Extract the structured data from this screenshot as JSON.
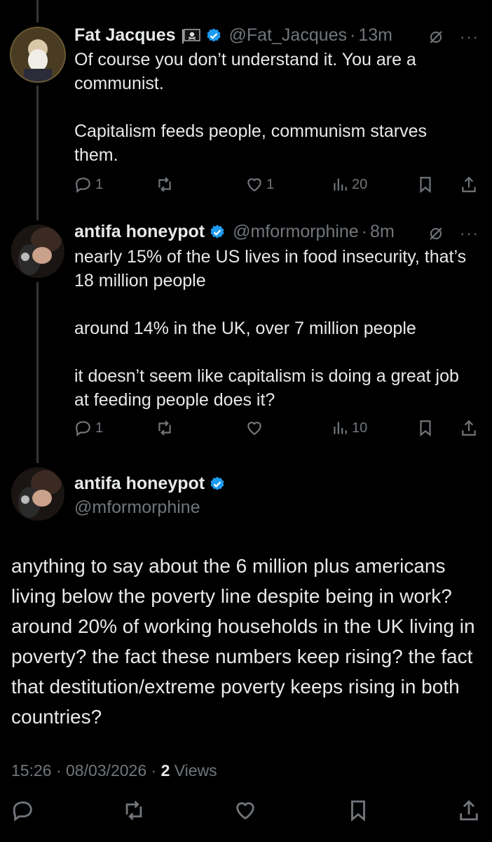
{
  "tweets": [
    {
      "name": "Fat Jacques",
      "handle": "@Fat_Jacques",
      "separator": "·",
      "time": "13m",
      "text": "Of course you don’t understand it. You are a communist.\n\nCapitalism feeds people, communism starves them.",
      "replies": "1",
      "reposts": "",
      "likes": "1",
      "views": "20"
    },
    {
      "name": "antifa honeypot",
      "handle": "@mformorphine",
      "separator": "·",
      "time": "8m",
      "text": "nearly 15% of the US lives in food insecurity, that’s 18 million people\n\naround 14% in the UK, over 7 million people\n\nit doesn’t seem like capitalism is doing a great job at feeding people does it?",
      "replies": "1",
      "reposts": "",
      "likes": "",
      "views": "10"
    }
  ],
  "main": {
    "name": "antifa honeypot",
    "handle": "@mformorphine",
    "text": "anything to say about the 6 million plus americans living below the poverty line despite being in work? around 20% of working households in the UK living in poverty? the fact these numbers keep rising? the fact that destitution/extreme poverty keeps rising in both countries?",
    "timestamp": "15:26 · 08/03/2026 · ",
    "views_count": "2",
    "views_label": " Views"
  },
  "colors": {
    "background": "#000000",
    "text": "#e7e9ea",
    "muted": "#71767b",
    "verified": "#1d9bf0"
  },
  "icons": [
    "reply-icon",
    "repost-icon",
    "like-icon",
    "views-icon",
    "bookmark-icon",
    "share-icon",
    "grok-icon",
    "more-icon",
    "verified-icon",
    "pirate-flag-icon"
  ]
}
